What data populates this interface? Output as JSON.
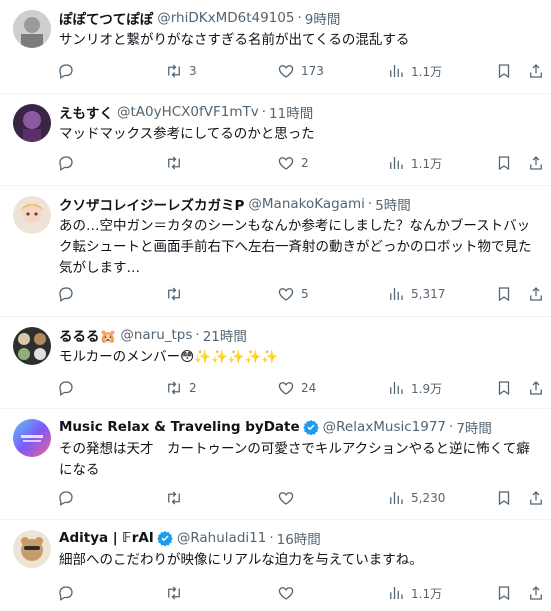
{
  "tweets": [
    {
      "name": "ぽぽてつてぽぽ",
      "handle": "@rhiDKxMD6t49105",
      "time": "9時間",
      "text": "サンリオと繋がりがなさすぎる名前が出てくるの混乱する",
      "replies": "",
      "retweets": "3",
      "likes": "173",
      "views": "1.1万",
      "verified": false,
      "avatar_color": "#c9c9c9"
    },
    {
      "name": "えもすく",
      "handle": "@tA0yHCX0fVF1mTv",
      "time": "11時間",
      "text": "マッドマックス参考にしてるのかと思った",
      "replies": "",
      "retweets": "",
      "likes": "2",
      "views": "1.1万",
      "verified": false,
      "avatar_color": "#6a3d7a"
    },
    {
      "name": "クソザコレイジーレズカガミP",
      "handle": "@ManakoKagami",
      "time": "5時間",
      "text": "あの…空中ガン＝カタのシーンもなんか参考にしました？なんかブーストバック転シュートと画面手前右下へ左右一斉射の動きがどっかのロボット物で見た気がします…",
      "replies": "",
      "retweets": "",
      "likes": "5",
      "views": "5,317",
      "verified": false,
      "avatar_color": "#e8d2c0"
    },
    {
      "name": "るるる🐹",
      "handle": "@naru_tps",
      "time": "21時間",
      "text": "モルカーのメンバー😳✨✨✨✨✨",
      "replies": "",
      "retweets": "2",
      "likes": "24",
      "views": "1.9万",
      "verified": false,
      "avatar_color": "#3a3a3a"
    },
    {
      "name": "Music Relax & Traveling byDate",
      "handle": "@RelaxMusic1977",
      "time": "7時間",
      "text": "その発想は天才　カートゥーンの可愛さでキルアクションやると逆に怖くて癖になる",
      "replies": "",
      "retweets": "",
      "likes": "",
      "views": "5,230",
      "verified": true,
      "avatar_color": "#7a6ad8"
    },
    {
      "name": "Aditya | 𝔽rAI",
      "handle": "@Rahuladi11",
      "time": "16時間",
      "text": "細部へのこだわりが映像にリアルな迫力を与えていますね。",
      "replies": "",
      "retweets": "",
      "likes": "",
      "views": "1.1万",
      "verified": true,
      "avatar_color": "#e9dccb"
    }
  ],
  "colors": {
    "text": "#0f1419",
    "secondary": "#536471",
    "divider": "#eff3f4",
    "verified": "#1d9bf0"
  },
  "icons": [
    "reply-icon",
    "retweet-icon",
    "like-icon",
    "views-icon",
    "bookmark-icon",
    "share-icon",
    "verified-badge-icon"
  ]
}
